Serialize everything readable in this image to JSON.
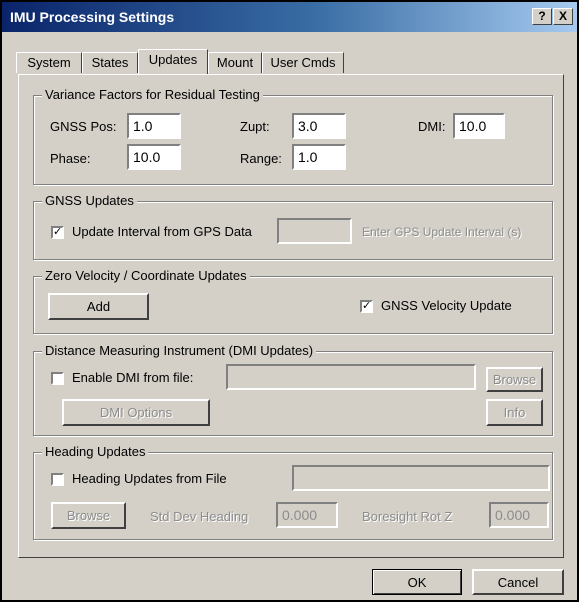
{
  "window": {
    "title": "IMU Processing Settings",
    "help_label": "?",
    "close_label": "X"
  },
  "tabs": [
    {
      "label": "System"
    },
    {
      "label": "States"
    },
    {
      "label": "Updates",
      "active": true
    },
    {
      "label": "Mount"
    },
    {
      "label": "User Cmds"
    }
  ],
  "variance": {
    "title": "Variance Factors for Residual Testing",
    "gnss_pos_label": "GNSS Pos:",
    "gnss_pos_value": "1.0",
    "zupt_label": "Zupt:",
    "zupt_value": "3.0",
    "dmi_label": "DMI:",
    "dmi_value": "10.0",
    "phase_label": "Phase:",
    "phase_value": "10.0",
    "range_label": "Range:",
    "range_value": "1.0"
  },
  "gnss_updates": {
    "title": "GNSS Updates",
    "interval_label": "Update Interval from GPS Data",
    "interval_checked": true,
    "interval_value": "",
    "interval_hint": "Enter GPS Update Interval (s)"
  },
  "zero_velocity": {
    "title": "Zero Velocity / Coordinate Updates",
    "add_label": "Add",
    "velocity_label": "GNSS Velocity Update",
    "velocity_checked": true
  },
  "dmi_updates": {
    "title": "Distance Measuring Instrument (DMI Updates)",
    "enable_label": "Enable DMI from file:",
    "enable_checked": false,
    "file_value": "",
    "browse_label": "Browse",
    "options_label": "DMI Options",
    "info_label": "Info"
  },
  "heading_updates": {
    "title": "Heading Updates",
    "file_label": "Heading Updates from File",
    "file_checked": false,
    "file_value": "",
    "browse_label": "Browse",
    "std_dev_label": "Std Dev Heading",
    "std_dev_value": "0.000",
    "boresight_label": "Boresight Rot Z",
    "boresight_value": "0.000"
  },
  "footer": {
    "ok_label": "OK",
    "cancel_label": "Cancel"
  }
}
